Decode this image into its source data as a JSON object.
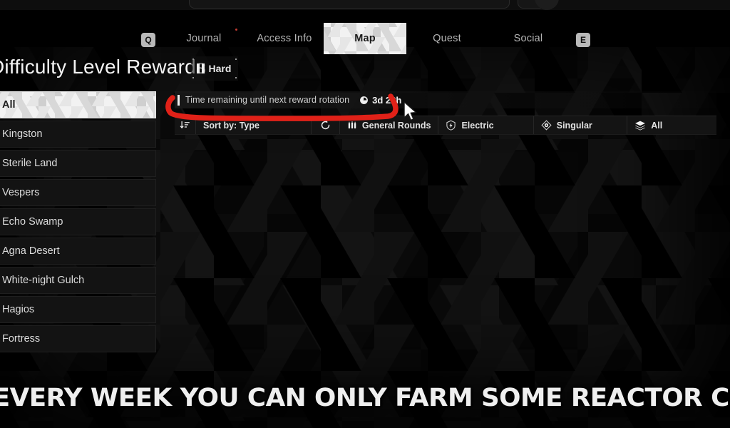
{
  "nav": {
    "left_key": "Q",
    "right_key": "E",
    "tabs": [
      {
        "label": "Journal",
        "active": false
      },
      {
        "label": "Access Info",
        "active": false
      },
      {
        "label": "Map",
        "active": true
      },
      {
        "label": "Quest",
        "active": false
      },
      {
        "label": "Social",
        "active": false
      }
    ]
  },
  "page": {
    "title": "Difficulty Level Rewards",
    "difficulty": "Hard"
  },
  "regions": {
    "items": [
      {
        "label": "All",
        "selected": true
      },
      {
        "label": "Kingston",
        "selected": false
      },
      {
        "label": "Sterile Land",
        "selected": false
      },
      {
        "label": "Vespers",
        "selected": false
      },
      {
        "label": "Echo Swamp",
        "selected": false
      },
      {
        "label": "Agna Desert",
        "selected": false
      },
      {
        "label": "White-night Gulch",
        "selected": false
      },
      {
        "label": "Hagios",
        "selected": false
      },
      {
        "label": "Fortress",
        "selected": false
      }
    ]
  },
  "timer": {
    "label": "Time remaining until next reward rotation",
    "value": "3d 22h",
    "icon": "clock-icon"
  },
  "filters": {
    "sort_icon": "sort-descending-icon",
    "sort_by": "Sort by: Type",
    "reset_icon": "refresh-icon",
    "rounds": "General Rounds",
    "rounds_icon": "ammo-icon",
    "element": "Electric",
    "element_icon": "electric-shield-icon",
    "archetype": "Singular",
    "archetype_icon": "singular-diamond-icon",
    "all": "All",
    "all_icon": "layers-icon"
  },
  "caption": {
    "text": "EVERY WEEK YOU CAN ONLY FARM SOME REACTOR COMBOS"
  },
  "colors": {
    "annotation_red": "#e02118",
    "accent_white": "#f2f2f2",
    "panel_dark": "#141414"
  }
}
